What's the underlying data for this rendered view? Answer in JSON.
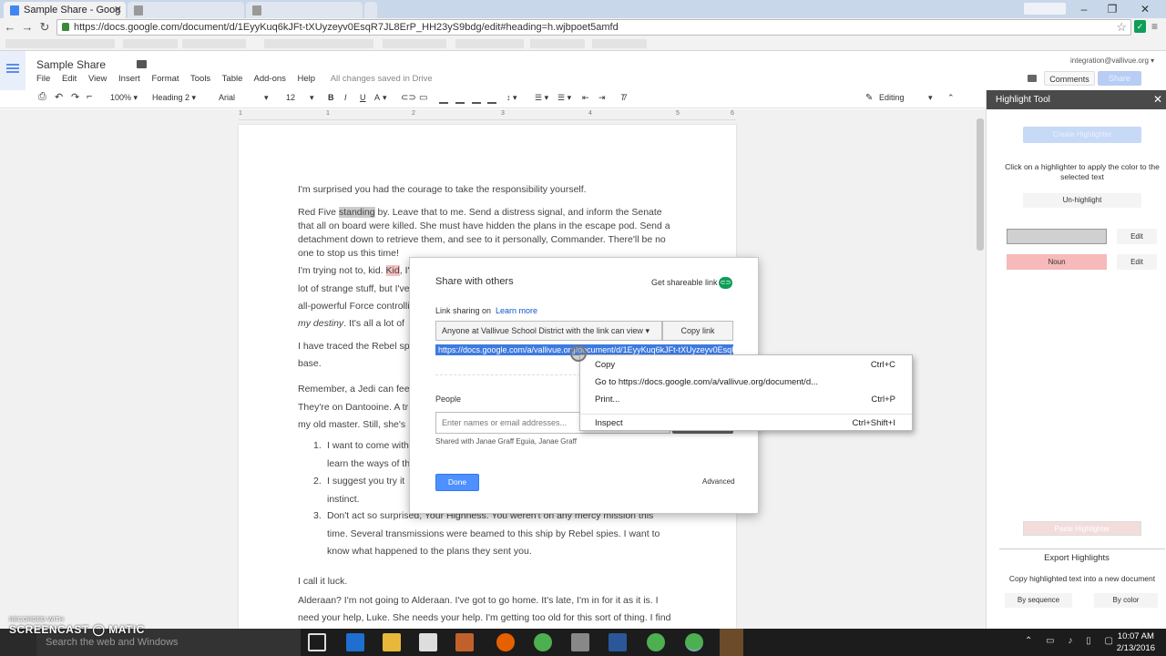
{
  "browser": {
    "active_tab": "Sample Share - Goog",
    "url": "https://docs.google.com/document/d/1EyyKuq6kJFt-tXUyzeyv0EsqR7JL8ErP_HH23yS9bdg/edit#heading=h.wjbpoet5amfd"
  },
  "docs": {
    "title": "Sample Share",
    "menu": [
      "File",
      "Edit",
      "View",
      "Insert",
      "Format",
      "Tools",
      "Table",
      "Add-ons",
      "Help"
    ],
    "saved_status": "All changes saved in Drive",
    "account": "integration@vallivue.org",
    "comments_label": "Comments",
    "share_label": "Share",
    "toolbar": {
      "zoom": "100%",
      "style": "Heading 2",
      "font": "Arial",
      "size": "12",
      "bold": "B",
      "italic": "I",
      "underline": "U",
      "text_color": "A",
      "editing": "Editing"
    },
    "ruler": [
      "1",
      "1",
      "2",
      "3",
      "4",
      "5",
      "6"
    ]
  },
  "document": {
    "p1": "I'm surprised you had the courage to take the responsibility yourself.",
    "p2_start": "Red Five ",
    "p2_hl": "standing",
    "p2_rest": " by. Leave that to me. Send a distress signal, and inform the Senate that all on board were killed. She must have hidden the plans in the escape pod. Send a detachment down to retrieve them, and see to it personally, Commander. There'll be no one to stop us this time!",
    "p3_start": "I'm trying not to, kid. ",
    "p3_hl": "Kid",
    "p3_line1_end": ", I've",
    "p3_line2": "lot of strange stuff, but I've",
    "p3_line3": "all-powerful Force controlling",
    "p3_line4_i": "my destiny",
    "p3_line4_rest": ". It's all a lot of",
    "p4_line1": "I have traced the Rebel spi",
    "p4_line2": "base.",
    "p5_line1": "Remember, a Jedi can feel",
    "p5_line2": "They're on Dantooine. A tr",
    "p5_line3": "my old master. Still, she's",
    "list": [
      {
        "num": "1.",
        "line1": "I want to come with",
        "line2": "learn the ways of th"
      },
      {
        "num": "2.",
        "line1": "I suggest you try it",
        "line2": "instinct."
      },
      {
        "num": "3.",
        "line1": "Don't act so surprised, Your Highness. You weren't on any mercy mission this",
        "line2": "time. Several transmissions were beamed to this ship by Rebel spies. I want to",
        "line3": "know what happened to the plans they sent you."
      }
    ],
    "p6": "I call it luck.",
    "p7_line1": "Alderaan? I'm not going to Alderaan. I've got to go home. It's late, I'm in for it as it is. I",
    "p7_line2": "need your help, Luke. She needs your help. I'm getting too old for this sort of thing. I find"
  },
  "share_dialog": {
    "title": "Share with others",
    "get_link": "Get shareable link",
    "link_sharing": "Link sharing on",
    "learn_more": "Learn more",
    "access": "Anyone at Vallivue School District with the link can view",
    "copy_link": "Copy link",
    "url": "https://docs.google.com/a/vallivue.org/document/d/1EyyKuq6kJFt-tXUyzeyv0EsqR",
    "people": "People",
    "names_placeholder": "Enter names or email addresses...",
    "shared_with": "Shared with Janae Graff Eguia, Janae Graff",
    "done": "Done",
    "advanced": "Advanced"
  },
  "context_menu": {
    "items": [
      {
        "label": "Copy",
        "shortcut": "Ctrl+C"
      },
      {
        "label": "Go to https://docs.google.com/a/vallivue.org/document/d...",
        "shortcut": ""
      },
      {
        "label": "Print...",
        "shortcut": "Ctrl+P"
      },
      {
        "label": "Inspect",
        "shortcut": "Ctrl+Shift+I"
      }
    ]
  },
  "highlight_panel": {
    "title": "Highlight Tool",
    "create": "Create Highlighter",
    "help": "Click on a highlighter to apply the color to the selected text",
    "unhighlight": "Un-highlight",
    "swatch2_label": "Noun",
    "edit": "Edit",
    "paste": "Paste Highlighter",
    "export_title": "Export Highlights",
    "export_help": "Copy highlighted text into a new document",
    "by_sequence": "By sequence",
    "by_color": "By color"
  },
  "taskbar": {
    "search": "Search the web and Windows",
    "time": "10:07 AM",
    "date": "2/13/2016"
  },
  "watermark": {
    "small": "RECORDED WITH",
    "big": "SCREENCAST ◯ MATIC"
  },
  "colors": {
    "tab_strip": "#c9d7ea",
    "link_blue": "#15c",
    "done_blue": "#4d90fe",
    "selection_blue": "#3d7ae0",
    "noun_pink": "#f7b9b9",
    "panel_header": "#4a4a4a"
  }
}
